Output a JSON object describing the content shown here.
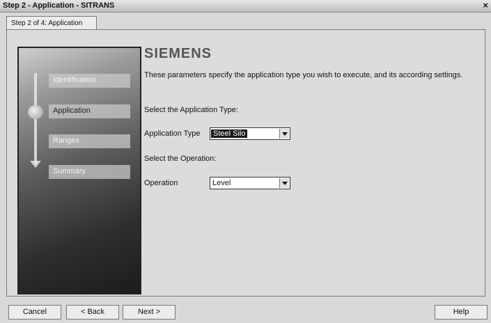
{
  "window": {
    "title": "Step 2 - Application - SITRANS",
    "close_label": "×"
  },
  "tab": {
    "label": "Step 2 of 4: Application"
  },
  "nav": {
    "items": [
      {
        "label": "Identification",
        "active": false
      },
      {
        "label": "Application",
        "active": true
      },
      {
        "label": "Ranges",
        "active": false
      },
      {
        "label": "Summary",
        "active": false
      }
    ]
  },
  "main": {
    "logo": "SIEMENS",
    "description": "These parameters specify the application type you wish to execute, and its according settings.",
    "select_app_heading": "Select the Application Type:",
    "app_type_label": "Application Type",
    "app_type_value": "Steel Silo",
    "select_op_heading": "Select the Operation:",
    "operation_label": "Operation",
    "operation_value": "Level"
  },
  "buttons": {
    "cancel": "Cancel",
    "back": "< Back",
    "next": "Next >",
    "help": "Help"
  },
  "icons": {
    "close": "close-icon",
    "dropdown": "chevron-down-icon"
  }
}
